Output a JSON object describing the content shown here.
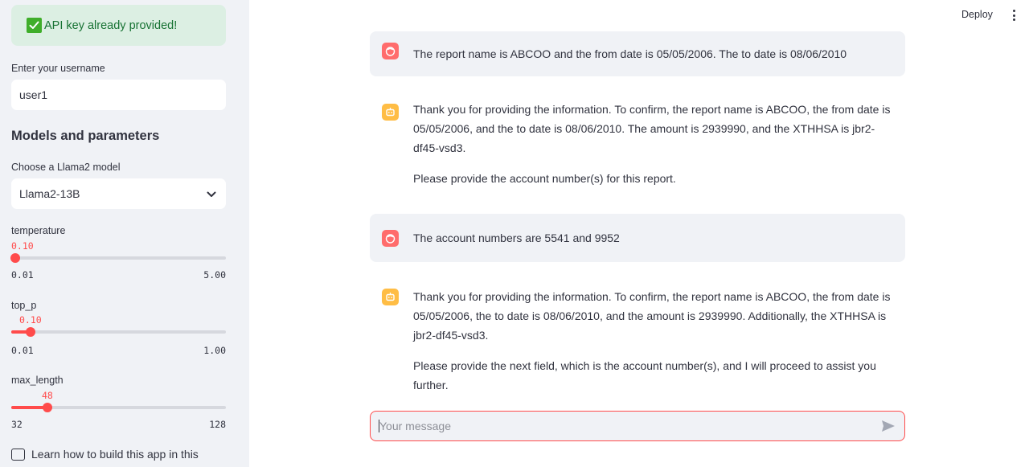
{
  "sidebar": {
    "api_status": "API key already provided!",
    "username_label": "Enter your username",
    "username_value": "user1",
    "section_title": "Models and parameters",
    "model_label": "Choose a Llama2 model",
    "model_selected": "Llama2-13B",
    "sliders": {
      "temperature": {
        "label": "temperature",
        "value": "0.10",
        "min": "0.01",
        "max": "5.00",
        "fraction": 0.018
      },
      "top_p": {
        "label": "top_p",
        "value": "0.10",
        "min": "0.01",
        "max": "1.00",
        "fraction": 0.091
      },
      "max_length": {
        "label": "max_length",
        "value": "48",
        "min": "32",
        "max": "128",
        "fraction": 0.167
      }
    },
    "checkbox_label": "Learn how to build this app in this"
  },
  "header": {
    "deploy_label": "Deploy"
  },
  "chat": {
    "messages": [
      {
        "role": "user",
        "text": "The report name is ABCOO and the from date is 05/05/2006. The to date is 08/06/2010"
      },
      {
        "role": "assistant",
        "p1": "Thank you for providing the information. To confirm, the report name is ABCOO, the from date is 05/05/2006, and the to date is 08/06/2010. The amount is 2939990, and the XTHHSA is jbr2-df45-vsd3.",
        "p2": "Please provide the account number(s) for this report."
      },
      {
        "role": "user",
        "text": "The account numbers are 5541 and 9952"
      },
      {
        "role": "assistant",
        "p1": "Thank you for providing the information. To confirm, the report name is ABCOO, the from date is 05/05/2006, the to date is 08/06/2010, and the amount is 2939990. Additionally, the XTHHSA is jbr2-df45-vsd3.",
        "p2": "Please provide the next field, which is the account number(s), and I will proceed to assist you further."
      }
    ],
    "input_placeholder": "Your message"
  },
  "colors": {
    "accent": "#ff4b4b",
    "user_avatar": "#ff6c6c",
    "bot_avatar": "#ffbd45",
    "success_bg": "#dcefe3",
    "success_text": "#177233"
  },
  "icons": {
    "api_status": "check-icon",
    "select": "chevron-down-icon",
    "user_avatar": "user-face-icon",
    "bot_avatar": "robot-icon",
    "send": "send-icon",
    "menu": "kebab-menu-icon"
  }
}
